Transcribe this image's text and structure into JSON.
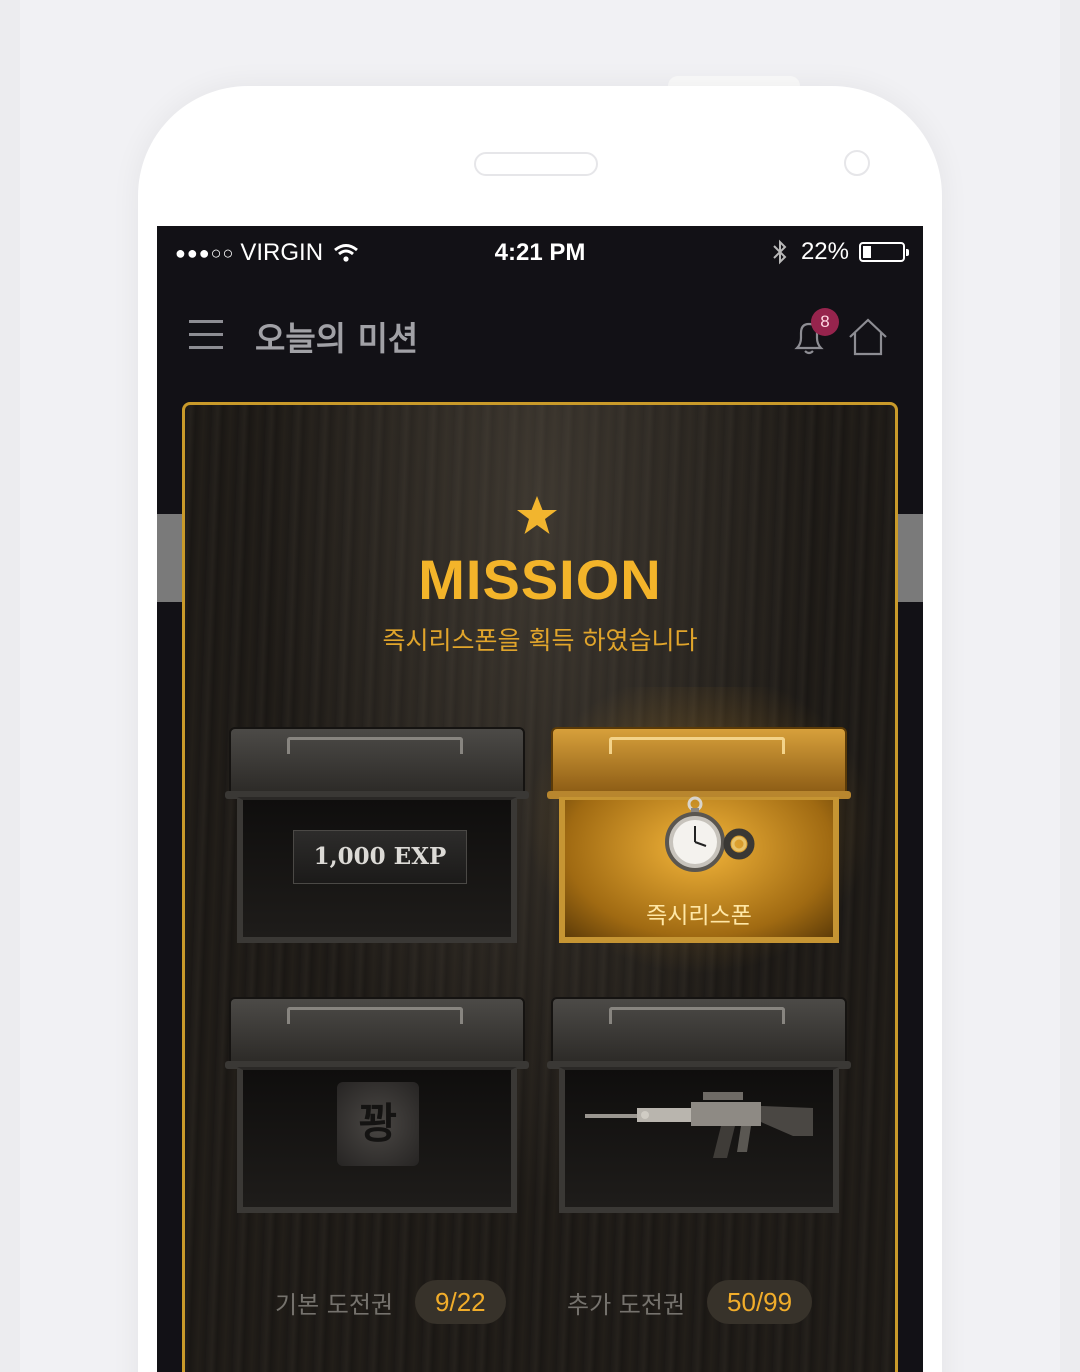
{
  "status_bar": {
    "signal_dots": "●●●○○",
    "carrier": "VIRGIN",
    "time": "4:21 PM",
    "battery_text": "22%",
    "battery_level": 0.22
  },
  "header": {
    "title": "오늘의 미션",
    "notification_count": "8"
  },
  "mission": {
    "heading": "MISSION",
    "subtitle": "즉시리스폰을 획득 하였습니다"
  },
  "boxes": [
    {
      "state": "closed",
      "reward_label": "1,000 EXP"
    },
    {
      "state": "opened",
      "reward_label": "즉시리스폰",
      "icon": "stopwatch-icon"
    },
    {
      "state": "closed",
      "reward_label": "꽝"
    },
    {
      "state": "closed",
      "reward_icon": "rifle-icon"
    }
  ],
  "tickets": {
    "basic": {
      "label": "기본 도전권",
      "value": "9/22"
    },
    "extra": {
      "label": "추가 도전권",
      "value": "50/99"
    }
  },
  "colors": {
    "accent": "#f3b42a",
    "badge": "#96244d",
    "background": "#121116"
  }
}
